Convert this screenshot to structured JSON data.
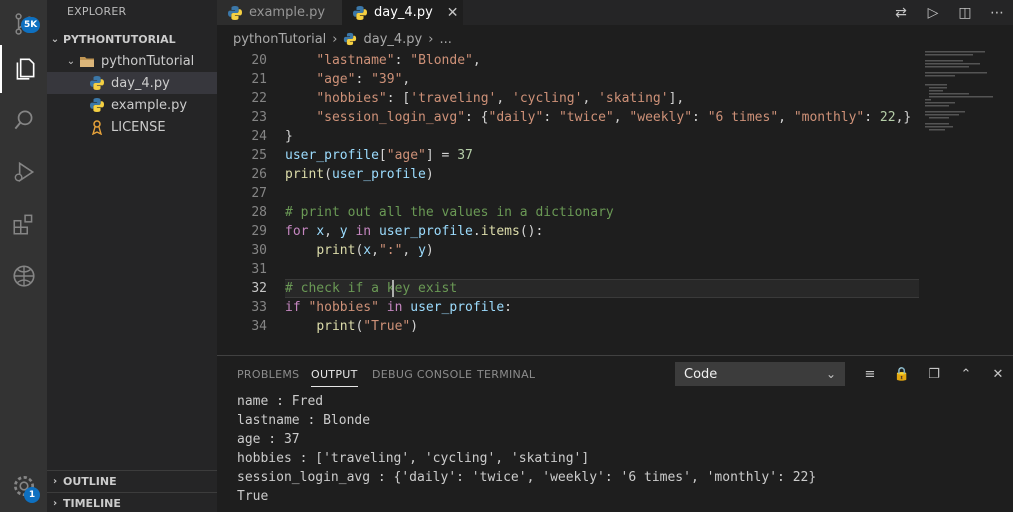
{
  "activity": {
    "scm_badge": "5K",
    "settings_badge": "1"
  },
  "sidebar": {
    "title": "EXPLORER",
    "workspace": "PYTHONTUTORIAL",
    "folder": "pythonTutorial",
    "files": [
      "day_4.py",
      "example.py",
      "LICENSE"
    ],
    "outline": "OUTLINE",
    "timeline": "TIMELINE"
  },
  "tabs": [
    {
      "label": "example.py",
      "active": false
    },
    {
      "label": "day_4.py",
      "active": true
    }
  ],
  "breadcrumb": {
    "folder": "pythonTutorial",
    "file": "day_4.py",
    "more": "..."
  },
  "editor": {
    "line_numbers": [
      "20",
      "21",
      "22",
      "23",
      "24",
      "25",
      "26",
      "27",
      "28",
      "29",
      "30",
      "31",
      "32",
      "33",
      "34"
    ],
    "current_line": "32"
  },
  "panel": {
    "tabs": [
      "PROBLEMS",
      "OUTPUT",
      "DEBUG CONSOLE",
      "TERMINAL"
    ],
    "active_tab": "OUTPUT",
    "channel": "Code",
    "output": [
      "name : Fred",
      "lastname : Blonde",
      "age : 37",
      "hobbies : ['traveling', 'cycling', 'skating']",
      "session_login_avg : {'daily': 'twice', 'weekly': '6 times', 'monthly': 22}",
      "True"
    ]
  },
  "colors": {
    "activity_bg": "#333333",
    "sidebar_bg": "#252526",
    "editor_bg": "#1e1e1e",
    "string": "#ce9178",
    "keyword": "#c586c0",
    "function": "#dcdcaa",
    "comment": "#6a9955",
    "accent": "#0e70c0"
  }
}
